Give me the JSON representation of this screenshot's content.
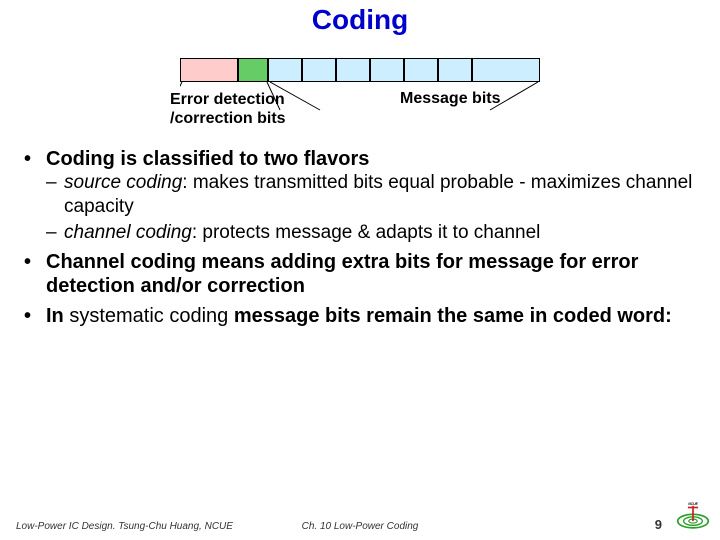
{
  "title": "Coding",
  "diagram": {
    "labelLeft1": "Error detection",
    "labelLeft2": "/correction bits",
    "labelRight": "Message bits"
  },
  "bullets": {
    "b1": "Coding is classified to two flavors",
    "b1s1a": "source coding",
    "b1s1b": ": makes transmitted bits equal probable - maximizes channel capacity",
    "b1s2a": "channel coding",
    "b1s2b": ": protects message & adapts it to channel",
    "b2": "Channel coding means adding extra bits for message for error detection and/or correction",
    "b3a": "In ",
    "b3b": "systematic coding",
    "b3c": " message bits remain the same in coded word:"
  },
  "footer": {
    "left": "Low-Power IC Design. Tsung-Chu Huang, NCUE",
    "center": "Ch. 10 Low-Power Coding",
    "page": "9"
  }
}
